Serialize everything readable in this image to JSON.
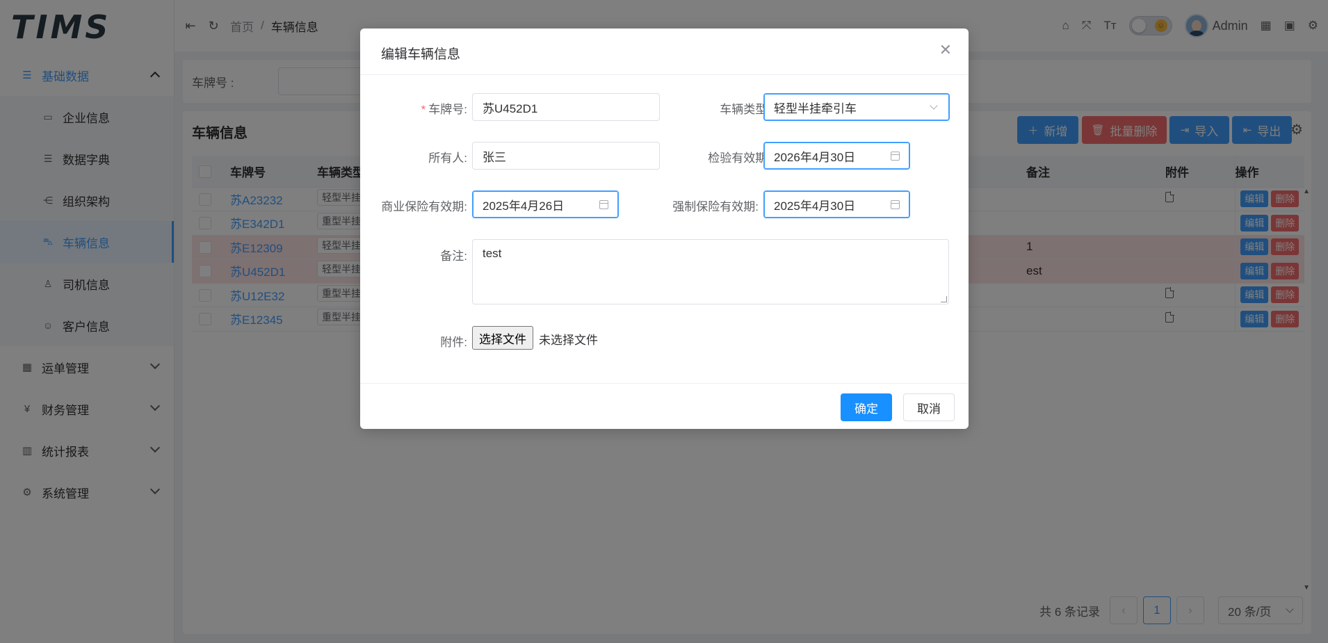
{
  "app": {
    "logo": "TIMS"
  },
  "sidebar": {
    "groups": [
      {
        "label": "基础数据",
        "icon": "list-icon",
        "open": true
      },
      {
        "label": "运单管理",
        "icon": "grid-icon"
      },
      {
        "label": "财务管理",
        "icon": "yen-icon"
      },
      {
        "label": "统计报表",
        "icon": "bar-chart-icon"
      },
      {
        "label": "系统管理",
        "icon": "gear-icon"
      }
    ],
    "sub_items": [
      {
        "label": "企业信息",
        "icon": "id-card-icon"
      },
      {
        "label": "数据字典",
        "icon": "list-icon"
      },
      {
        "label": "组织架构",
        "icon": "org-icon"
      },
      {
        "label": "车辆信息",
        "icon": "car-icon",
        "active": true
      },
      {
        "label": "司机信息",
        "icon": "user-icon"
      },
      {
        "label": "客户信息",
        "icon": "customer-icon"
      }
    ]
  },
  "header": {
    "breadcrumb": {
      "home": "首页",
      "separator": "/",
      "current": "车辆信息"
    },
    "user": "Admin"
  },
  "search": {
    "plate_label": "车牌号 :"
  },
  "table_card": {
    "title": "车辆信息",
    "buttons": {
      "add": "新增",
      "batch_delete": "批量删除",
      "import": "导入",
      "export": "导出"
    },
    "columns": {
      "plate": "车牌号",
      "type": "车辆类型",
      "remark": "备注",
      "attachment": "附件",
      "actions": "操作"
    },
    "rows": [
      {
        "plate": "苏A23232",
        "type": "轻型半挂牵引车",
        "remark": "",
        "has_file": true,
        "highlight": false
      },
      {
        "plate": "苏E342D1",
        "type": "重型半挂牵引车",
        "remark": "",
        "has_file": false,
        "highlight": false
      },
      {
        "plate": "苏E12309",
        "type": "轻型半挂牵引车",
        "remark": "1",
        "has_file": false,
        "highlight": true
      },
      {
        "plate": "苏U452D1",
        "type": "轻型半挂牵引车",
        "remark": "est",
        "has_file": false,
        "highlight": true
      },
      {
        "plate": "苏U12E32",
        "type": "重型半挂牵引车",
        "remark": "",
        "has_file": true,
        "highlight": false
      },
      {
        "plate": "苏E12345",
        "type": "重型半挂牵引车",
        "remark": "",
        "has_file": true,
        "highlight": false
      }
    ],
    "row_actions": {
      "edit": "编辑",
      "delete": "删除"
    }
  },
  "pagination": {
    "total_text": "共 6 条记录",
    "current_page": "1",
    "page_size": "20 条/页"
  },
  "dialog": {
    "title": "编辑车辆信息",
    "fields": {
      "plate": {
        "label": "车牌号:",
        "value": "苏U452D1",
        "required_mark": "*"
      },
      "vehicle_type": {
        "label": "车辆类型:",
        "value": "轻型半挂牵引车"
      },
      "owner": {
        "label": "所有人:",
        "value": "张三"
      },
      "inspection_expiry": {
        "label": "检验有效期:",
        "value": "2026年4月30日"
      },
      "commercial_insurance_expiry": {
        "label": "商业保险有效期:",
        "value": "2025年4月26日"
      },
      "compulsory_insurance_expiry": {
        "label": "强制保险有效期:",
        "value": "2025年4月30日"
      },
      "remark": {
        "label": "备注:",
        "value": "test"
      },
      "attachment": {
        "label": "附件:",
        "choose_button": "选择文件",
        "no_file_text": "未选择文件"
      }
    },
    "buttons": {
      "confirm": "确定",
      "cancel": "取消"
    }
  },
  "colors": {
    "primary": "#409eff",
    "danger": "#f56c6c",
    "row_highlight": "#fde2e2"
  }
}
